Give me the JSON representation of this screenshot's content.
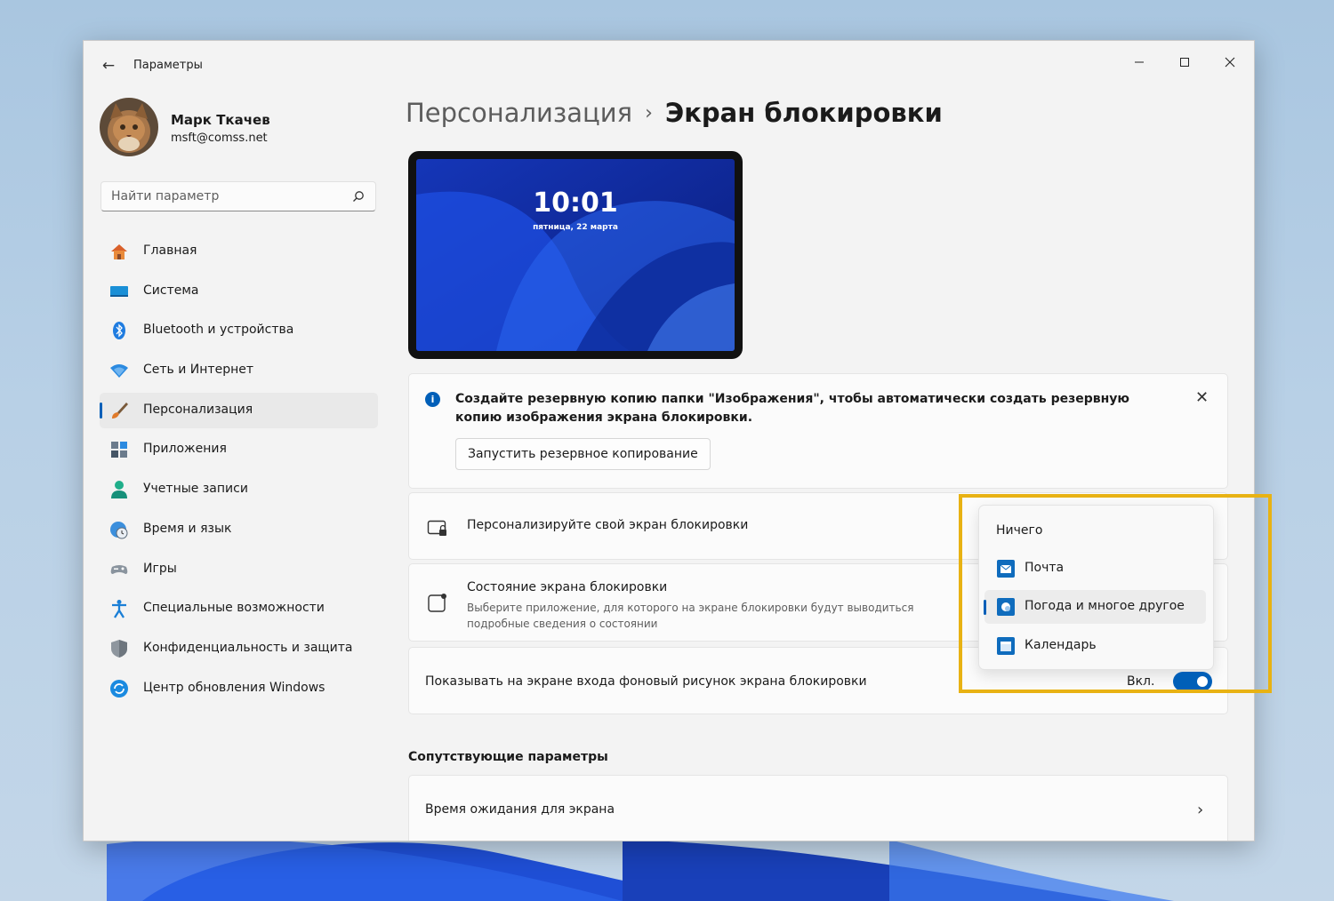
{
  "window": {
    "app_title": "Параметры",
    "back_icon": "arrow-left-icon",
    "controls": {
      "minimize": "—",
      "maximize": "☐",
      "close": "✕"
    }
  },
  "profile": {
    "name": "Марк Ткачев",
    "email": "msft@comss.net"
  },
  "search": {
    "placeholder": "Найти параметр",
    "icon": "search-icon"
  },
  "nav": {
    "items": [
      {
        "label": "Главная",
        "icon": "home-icon"
      },
      {
        "label": "Система",
        "icon": "system-icon"
      },
      {
        "label": "Bluetooth и устройства",
        "icon": "bluetooth-icon"
      },
      {
        "label": "Сеть и Интернет",
        "icon": "wifi-icon"
      },
      {
        "label": "Персонализация",
        "icon": "brush-icon",
        "active": true
      },
      {
        "label": "Приложения",
        "icon": "apps-icon"
      },
      {
        "label": "Учетные записи",
        "icon": "account-icon"
      },
      {
        "label": "Время и язык",
        "icon": "globe-clock-icon"
      },
      {
        "label": "Игры",
        "icon": "gamepad-icon"
      },
      {
        "label": "Специальные возможности",
        "icon": "accessibility-icon"
      },
      {
        "label": "Конфиденциальность и защита",
        "icon": "shield-icon"
      },
      {
        "label": "Центр обновления Windows",
        "icon": "update-icon"
      }
    ]
  },
  "breadcrumb": {
    "parent": "Персонализация",
    "separator": "›",
    "current": "Экран блокировки"
  },
  "preview": {
    "time": "10:01",
    "date": "пятница, 22 марта"
  },
  "info_banner": {
    "text": "Создайте резервную копию папки \"Изображения\", чтобы автоматически создать резервную копию изображения экрана блокировки.",
    "button": "Запустить резервное копирование",
    "close": "✕"
  },
  "settings": {
    "personalize": {
      "title": "Персонализируйте свой экран блокировки",
      "icon": "lock-screen-icon"
    },
    "status": {
      "title": "Состояние экрана блокировки",
      "description": "Выберите приложение, для которого на экране блокировки будут выводиться подробные сведения о состоянии",
      "icon": "status-icon"
    },
    "signin_background": {
      "title": "Показывать на экране входа фоновый рисунок экрана блокировки",
      "toggle_label": "Вкл.",
      "toggle_on": true
    }
  },
  "dropdown": {
    "options": [
      {
        "label": "Ничего",
        "icon": null
      },
      {
        "label": "Почта",
        "icon": "mail-icon"
      },
      {
        "label": "Погода и многое другое",
        "icon": "weather-icon",
        "selected": true
      },
      {
        "label": "Календарь",
        "icon": "calendar-icon"
      }
    ]
  },
  "related": {
    "title": "Сопутствующие параметры",
    "items": [
      {
        "label": "Время ожидания для экрана"
      }
    ]
  },
  "colors": {
    "accent": "#005fb8",
    "highlight": "#e8b213"
  }
}
